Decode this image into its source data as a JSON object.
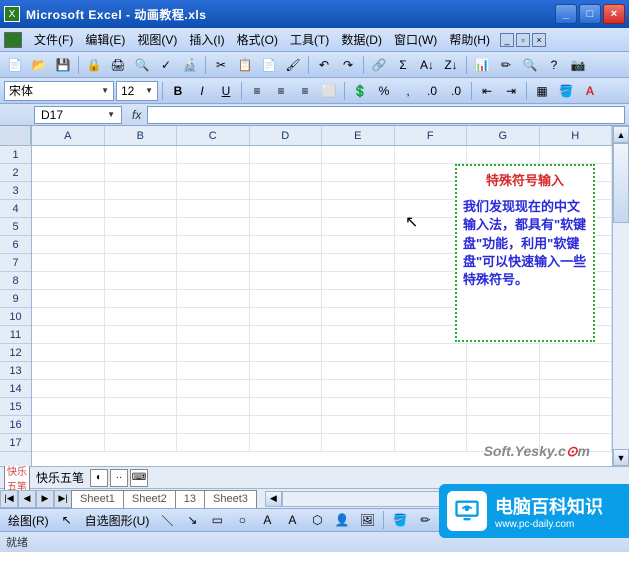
{
  "title": "Microsoft Excel - 动画教程.xls",
  "menu": [
    "文件(F)",
    "编辑(E)",
    "视图(V)",
    "插入(I)",
    "格式(O)",
    "工具(T)",
    "数据(D)",
    "窗口(W)",
    "帮助(H)"
  ],
  "menu_help_hint": "_ ▫ ×",
  "font": {
    "name": "宋体",
    "size": "12"
  },
  "namebox": "D17",
  "fx_label": "fx",
  "columns": [
    "A",
    "B",
    "C",
    "D",
    "E",
    "F",
    "G",
    "H"
  ],
  "rows": [
    "1",
    "2",
    "3",
    "4",
    "5",
    "6",
    "7",
    "8",
    "9",
    "10",
    "11",
    "12",
    "13",
    "14",
    "15",
    "16",
    "17"
  ],
  "textbox": {
    "title": "特殊符号输入",
    "body": "我们发现现在的中文输入法，都具有\"软键盘\"功能，利用\"软键盘\"可以快速输入一些特殊符号。"
  },
  "ime": {
    "badge": "快乐五笔",
    "name": "快乐五笔"
  },
  "tabs": [
    "Sheet1",
    "Sheet2",
    "13",
    "Sheet3"
  ],
  "draw": {
    "label": "绘图(R)",
    "autoshape": "自选图形(U)"
  },
  "status": "就绪",
  "watermark": {
    "text": "Soft.Yesky.c",
    "suffix": "m"
  },
  "logo": {
    "main": "电脑百科知识",
    "sub": "www.pc-daily.com"
  }
}
